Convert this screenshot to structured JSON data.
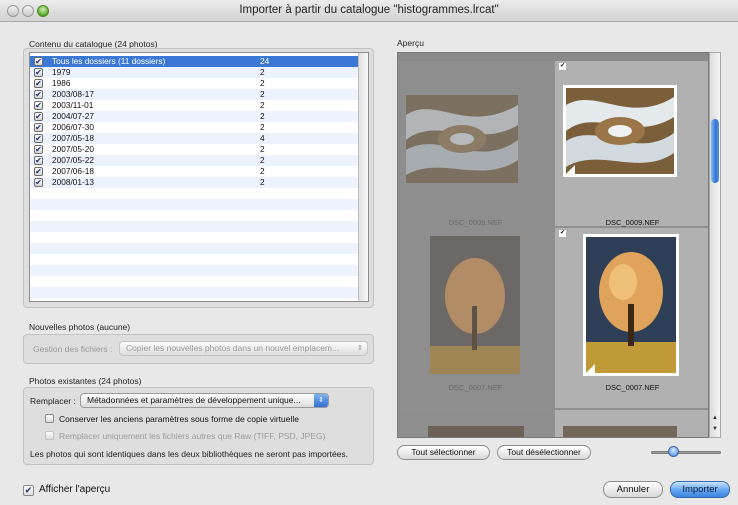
{
  "window": {
    "title": "Importer à partir du catalogue \"histogrammes.lrcat\""
  },
  "catalog": {
    "label": "Contenu du catalogue (24 photos)",
    "rows": [
      {
        "name": "Tous les dossiers (11 dossiers)",
        "count": "24",
        "checked": true,
        "selected": true
      },
      {
        "name": "1979",
        "count": "2",
        "checked": true
      },
      {
        "name": "1986",
        "count": "2",
        "checked": true
      },
      {
        "name": "2003/08-17",
        "count": "2",
        "checked": true
      },
      {
        "name": "2003/11-01",
        "count": "2",
        "checked": true
      },
      {
        "name": "2004/07-27",
        "count": "2",
        "checked": true
      },
      {
        "name": "2006/07-30",
        "count": "2",
        "checked": true
      },
      {
        "name": "2007/05-18",
        "count": "4",
        "checked": true
      },
      {
        "name": "2007/05-20",
        "count": "2",
        "checked": true
      },
      {
        "name": "2007/05-22",
        "count": "2",
        "checked": true
      },
      {
        "name": "2007/06-18",
        "count": "2",
        "checked": true
      },
      {
        "name": "2008/01-13",
        "count": "2",
        "checked": true
      }
    ]
  },
  "new_photos": {
    "label": "Nouvelles photos (aucune)",
    "file_handling_label": "Gestion des fichiers :",
    "file_handling_value": "Copier les nouvelles photos dans un nouvel emplacem..."
  },
  "existing_photos": {
    "label": "Photos existantes (24 photos)",
    "replace_label": "Remplacer :",
    "replace_value": "Métadonnées et paramètres de développement unique...",
    "keep_old_label": "Conserver les anciens paramètres sous forme de copie virtuelle",
    "replace_nonraw_label": "Remplacer uniquement les fichiers autres que Raw (TIFF, PSD, JPEG)",
    "note": "Les photos qui sont identiques dans les deux bibliothèques ne seront pas importées."
  },
  "preview": {
    "label": "Aperçu",
    "cells": [
      {
        "filename": "DSC_0009.NEF",
        "selected": false,
        "image": "swirl"
      },
      {
        "filename": "DSC_0009.NEF",
        "selected": true,
        "image": "swirl"
      },
      {
        "filename": "DSC_0007.NEF",
        "selected": false,
        "image": "tree"
      },
      {
        "filename": "DSC_0007.NEF",
        "selected": true,
        "image": "tree"
      }
    ],
    "select_all": "Tout sélectionner",
    "deselect_all": "Tout désélectionner"
  },
  "footer": {
    "show_preview_label": "Afficher l'aperçu",
    "cancel": "Annuler",
    "import": "Importer"
  },
  "colors": {
    "selection_blue": "#3b78d6",
    "accent_button": "#3a83df"
  }
}
